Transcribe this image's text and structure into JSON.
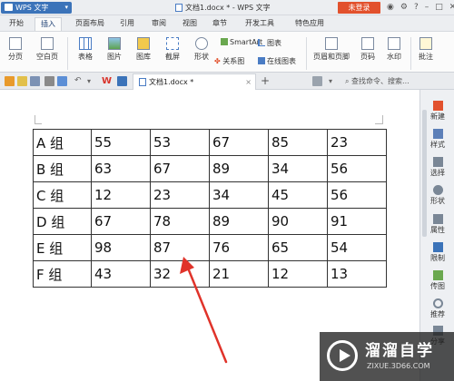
{
  "titlebar": {
    "app_name": "WPS 文字",
    "doc_title": "文档1.docx * - WPS 文字",
    "login_label": "未登录"
  },
  "menu_tabs": [
    "开始",
    "插入",
    "页面布局",
    "引用",
    "审阅",
    "视图",
    "章节",
    "开发工具",
    "特色应用"
  ],
  "active_tab": "插入",
  "ribbon": {
    "row1": [
      "SmartArt",
      "图表"
    ],
    "items": [
      "分页",
      "空白页",
      "表格",
      "图片",
      "图库",
      "截屏",
      "形状",
      "关系图",
      "在线图表",
      "页眉和页脚",
      "页码",
      "水印",
      "批注"
    ]
  },
  "doc_tab": {
    "label": "文档1.docx *",
    "close": "×"
  },
  "add_tab": "+",
  "search_command": "查找命令、搜索...",
  "table": {
    "rows": [
      [
        "A 组",
        "55",
        "53",
        "67",
        "85",
        "23"
      ],
      [
        "B 组",
        "63",
        "67",
        "89",
        "34",
        "56"
      ],
      [
        "C 组",
        "12",
        "23",
        "34",
        "45",
        "56"
      ],
      [
        "D 组",
        "67",
        "78",
        "89",
        "90",
        "91"
      ],
      [
        "E 组",
        "98",
        "87",
        "76",
        "65",
        "54"
      ],
      [
        "F 组",
        "43",
        "32",
        "21",
        "12",
        "13"
      ]
    ]
  },
  "right_panel": [
    "新建",
    "样式",
    "选择",
    "形状",
    "属性",
    "限制",
    "传图",
    "推荐",
    "分享"
  ],
  "watermark": {
    "brand": "溜溜自学",
    "url": "ZIXUE.3D66.COM"
  },
  "colors": {
    "accent": "#3b73b9",
    "login": "#e2512d",
    "arrow": "#e0332a"
  }
}
